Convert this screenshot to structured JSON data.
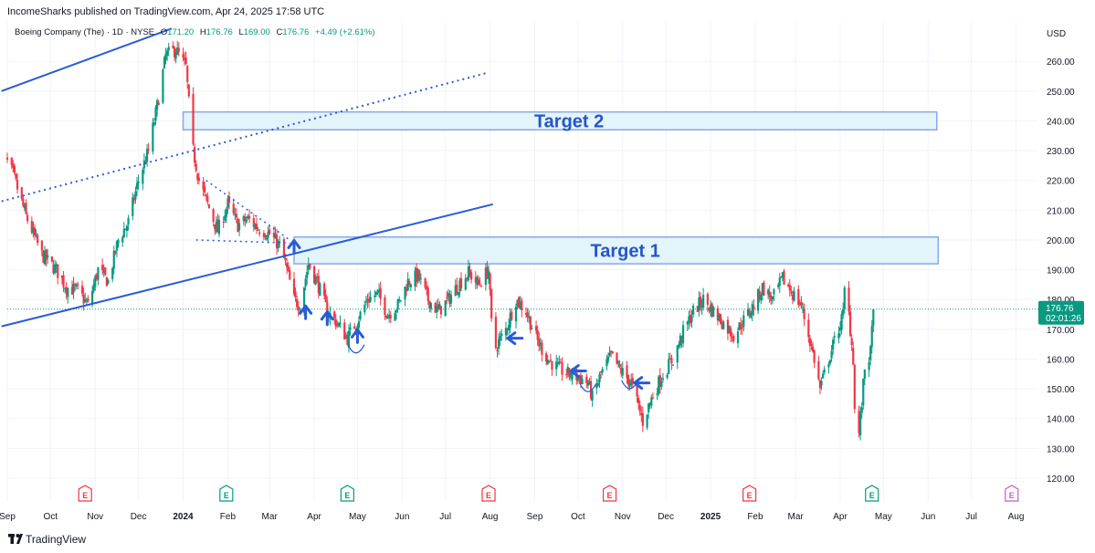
{
  "header": {
    "publisher_line": "IncomeSharks published on TradingView.com, Apr 24, 2025 17:58 UTC"
  },
  "legend": {
    "symbol": "Boeing Company (The) · 1D · NYSE",
    "o_label": "O",
    "o_value": "171.20",
    "h_label": "H",
    "h_value": "176.76",
    "l_label": "L",
    "l_value": "169.00",
    "c_label": "C",
    "c_value": "176.76",
    "change": "+4.49 (+2.61%)",
    "up_color": "#089981",
    "down_color": "#f23645"
  },
  "price_scale": {
    "currency": "USD",
    "last_price": "176.76",
    "countdown": "02:01:26",
    "last_price_color": "#089981"
  },
  "footer": {
    "brand": "TradingView",
    "logo_icon": "tradingview-logo-icon"
  },
  "chart_data": {
    "type": "candlestick",
    "title": "Boeing Company (The) · 1D · NYSE",
    "y_unit": "USD",
    "ylim": [
      115,
      272
    ],
    "y_ticks": [
      120,
      130,
      140,
      150,
      160,
      170,
      180,
      190,
      200,
      210,
      220,
      230,
      240,
      250,
      260
    ],
    "x_range": [
      "2023-09-01",
      "2025-08-07"
    ],
    "x_ticks": [
      {
        "date": "2023-09-01",
        "label": "Sep"
      },
      {
        "date": "2023-10-01",
        "label": "Oct"
      },
      {
        "date": "2023-11-01",
        "label": "Nov"
      },
      {
        "date": "2023-12-01",
        "label": "Dec"
      },
      {
        "date": "2024-01-01",
        "label": "2024",
        "bold": true
      },
      {
        "date": "2024-02-01",
        "label": "Feb"
      },
      {
        "date": "2024-03-01",
        "label": "Mar"
      },
      {
        "date": "2024-04-01",
        "label": "Apr"
      },
      {
        "date": "2024-05-01",
        "label": "May"
      },
      {
        "date": "2024-06-01",
        "label": "Jun"
      },
      {
        "date": "2024-07-01",
        "label": "Jul"
      },
      {
        "date": "2024-08-01",
        "label": "Aug"
      },
      {
        "date": "2024-09-01",
        "label": "Sep"
      },
      {
        "date": "2024-10-01",
        "label": "Oct"
      },
      {
        "date": "2024-11-01",
        "label": "Nov"
      },
      {
        "date": "2024-12-01",
        "label": "Dec"
      },
      {
        "date": "2025-01-01",
        "label": "2025",
        "bold": true
      },
      {
        "date": "2025-02-01",
        "label": "Feb"
      },
      {
        "date": "2025-03-01",
        "label": "Mar"
      },
      {
        "date": "2025-04-01",
        "label": "Apr"
      },
      {
        "date": "2025-05-01",
        "label": "May"
      },
      {
        "date": "2025-06-01",
        "label": "Jun"
      },
      {
        "date": "2025-07-01",
        "label": "Jul"
      },
      {
        "date": "2025-08-01",
        "label": "Aug"
      }
    ],
    "grid": true,
    "price_path": [
      [
        "2023-08-28",
        230
      ],
      [
        "2023-09-05",
        222
      ],
      [
        "2023-09-14",
        208
      ],
      [
        "2023-09-25",
        195
      ],
      [
        "2023-10-05",
        190
      ],
      [
        "2023-10-12",
        184
      ],
      [
        "2023-10-20",
        183
      ],
      [
        "2023-10-27",
        178
      ],
      [
        "2023-11-03",
        190
      ],
      [
        "2023-11-10",
        186
      ],
      [
        "2023-11-17",
        200
      ],
      [
        "2023-11-24",
        206
      ],
      [
        "2023-12-01",
        220
      ],
      [
        "2023-12-08",
        230
      ],
      [
        "2023-12-14",
        245
      ],
      [
        "2023-12-20",
        262
      ],
      [
        "2023-12-27",
        264
      ],
      [
        "2024-01-03",
        258
      ],
      [
        "2024-01-05",
        246
      ],
      [
        "2024-01-08",
        230
      ],
      [
        "2024-01-12",
        220
      ],
      [
        "2024-01-18",
        212
      ],
      [
        "2024-01-25",
        203
      ],
      [
        "2024-02-01",
        212
      ],
      [
        "2024-02-08",
        205
      ],
      [
        "2024-02-15",
        207
      ],
      [
        "2024-02-22",
        204
      ],
      [
        "2024-03-01",
        202
      ],
      [
        "2024-03-08",
        198
      ],
      [
        "2024-03-12",
        192
      ],
      [
        "2024-03-18",
        180
      ],
      [
        "2024-03-22",
        178
      ],
      [
        "2024-03-28",
        192
      ],
      [
        "2024-04-03",
        186
      ],
      [
        "2024-04-10",
        176
      ],
      [
        "2024-04-17",
        172
      ],
      [
        "2024-04-24",
        167
      ],
      [
        "2024-05-01",
        173
      ],
      [
        "2024-05-08",
        180
      ],
      [
        "2024-05-15",
        182
      ],
      [
        "2024-05-22",
        175
      ],
      [
        "2024-05-29",
        178
      ],
      [
        "2024-06-05",
        186
      ],
      [
        "2024-06-12",
        188
      ],
      [
        "2024-06-19",
        180
      ],
      [
        "2024-06-26",
        176
      ],
      [
        "2024-07-03",
        180
      ],
      [
        "2024-07-10",
        185
      ],
      [
        "2024-07-17",
        189
      ],
      [
        "2024-07-24",
        185
      ],
      [
        "2024-07-31",
        190
      ],
      [
        "2024-08-02",
        172
      ],
      [
        "2024-08-05",
        164
      ],
      [
        "2024-08-12",
        170
      ],
      [
        "2024-08-19",
        180
      ],
      [
        "2024-08-26",
        176
      ],
      [
        "2024-09-03",
        166
      ],
      [
        "2024-09-10",
        160
      ],
      [
        "2024-09-17",
        157
      ],
      [
        "2024-09-24",
        155
      ],
      [
        "2024-10-01",
        154
      ],
      [
        "2024-10-08",
        152
      ],
      [
        "2024-10-11",
        147
      ],
      [
        "2024-10-17",
        155
      ],
      [
        "2024-10-24",
        161
      ],
      [
        "2024-10-31",
        156
      ],
      [
        "2024-11-07",
        152
      ],
      [
        "2024-11-12",
        144
      ],
      [
        "2024-11-15",
        139
      ],
      [
        "2024-11-22",
        148
      ],
      [
        "2024-11-29",
        155
      ],
      [
        "2024-12-06",
        160
      ],
      [
        "2024-12-13",
        169
      ],
      [
        "2024-12-20",
        176
      ],
      [
        "2024-12-27",
        180
      ],
      [
        "2025-01-03",
        176
      ],
      [
        "2025-01-10",
        172
      ],
      [
        "2025-01-17",
        168
      ],
      [
        "2025-01-24",
        173
      ],
      [
        "2025-01-31",
        178
      ],
      [
        "2025-02-06",
        184
      ],
      [
        "2025-02-13",
        180
      ],
      [
        "2025-02-20",
        187
      ],
      [
        "2025-02-27",
        182
      ],
      [
        "2025-03-05",
        178
      ],
      [
        "2025-03-10",
        168
      ],
      [
        "2025-03-14",
        160
      ],
      [
        "2025-03-18",
        150
      ],
      [
        "2025-03-24",
        160
      ],
      [
        "2025-03-28",
        166
      ],
      [
        "2025-04-03",
        175
      ],
      [
        "2025-04-04",
        183
      ],
      [
        "2025-04-07",
        175
      ],
      [
        "2025-04-10",
        160
      ],
      [
        "2025-04-11",
        143
      ],
      [
        "2025-04-14",
        135
      ],
      [
        "2025-04-16",
        145
      ],
      [
        "2025-04-18",
        157
      ],
      [
        "2025-04-22",
        162
      ],
      [
        "2025-04-24",
        176.76
      ]
    ],
    "current_price": 176.76,
    "drawings": {
      "zones": [
        {
          "label": "Target 2",
          "from": "2024-01-01",
          "to": "2025-06-07",
          "low": 237,
          "high": 243
        },
        {
          "label": "Target 1",
          "from": "2024-03-18",
          "to": "2025-06-08",
          "low": 192,
          "high": 201
        }
      ],
      "channel_upper": [
        [
          "2023-08-28",
          250
        ],
        [
          "2023-12-24",
          271
        ]
      ],
      "channel_lower": [
        [
          "2023-08-28",
          171
        ],
        [
          "2024-08-03",
          212
        ]
      ],
      "channel_mid_dotted": [
        [
          "2023-08-28",
          213
        ],
        [
          "2024-07-29",
          256
        ]
      ],
      "wedge_dotted_upper": [
        [
          "2024-01-17",
          220
        ],
        [
          "2024-03-15",
          200
        ]
      ],
      "wedge_dotted_lower": [
        [
          "2024-01-10",
          200
        ],
        [
          "2024-03-15",
          199
        ]
      ],
      "arrows": [
        {
          "date": "2024-03-18",
          "price": 198,
          "dir": "up"
        },
        {
          "date": "2024-03-26",
          "price": 176,
          "dir": "up"
        },
        {
          "date": "2024-04-10",
          "price": 174,
          "dir": "up"
        },
        {
          "date": "2024-05-01",
          "price": 168,
          "dir": "up"
        },
        {
          "date": "2024-08-17",
          "price": 167,
          "dir": "left"
        },
        {
          "date": "2024-09-30",
          "price": 156,
          "dir": "left"
        },
        {
          "date": "2024-11-13",
          "price": 152,
          "dir": "left"
        }
      ],
      "cups": [
        {
          "date": "2024-04-30",
          "price": 163
        },
        {
          "date": "2024-10-08",
          "price": 150
        },
        {
          "date": "2024-11-06",
          "price": 151
        }
      ]
    },
    "earnings_markers": [
      {
        "date": "2023-10-25",
        "label": "E",
        "color": "#f23645"
      },
      {
        "date": "2024-01-31",
        "label": "E",
        "color": "#089981"
      },
      {
        "date": "2024-04-24",
        "label": "E",
        "color": "#089981"
      },
      {
        "date": "2024-07-31",
        "label": "E",
        "color": "#f23645"
      },
      {
        "date": "2024-10-23",
        "label": "E",
        "color": "#f23645"
      },
      {
        "date": "2025-01-28",
        "label": "E",
        "color": "#f23645"
      },
      {
        "date": "2025-04-23",
        "label": "E",
        "color": "#089981"
      },
      {
        "date": "2025-07-29",
        "label": "E",
        "color": "#c45ec4"
      }
    ],
    "colors": {
      "up": "#089981",
      "down": "#f23645",
      "drawing": "#2a5bd7",
      "zone_fill": "#e3f4fb",
      "zone_border": "#8aa8e8",
      "zone_text": "#2456c8",
      "grid": "#f0f3fa",
      "axis_text": "#131722"
    }
  }
}
